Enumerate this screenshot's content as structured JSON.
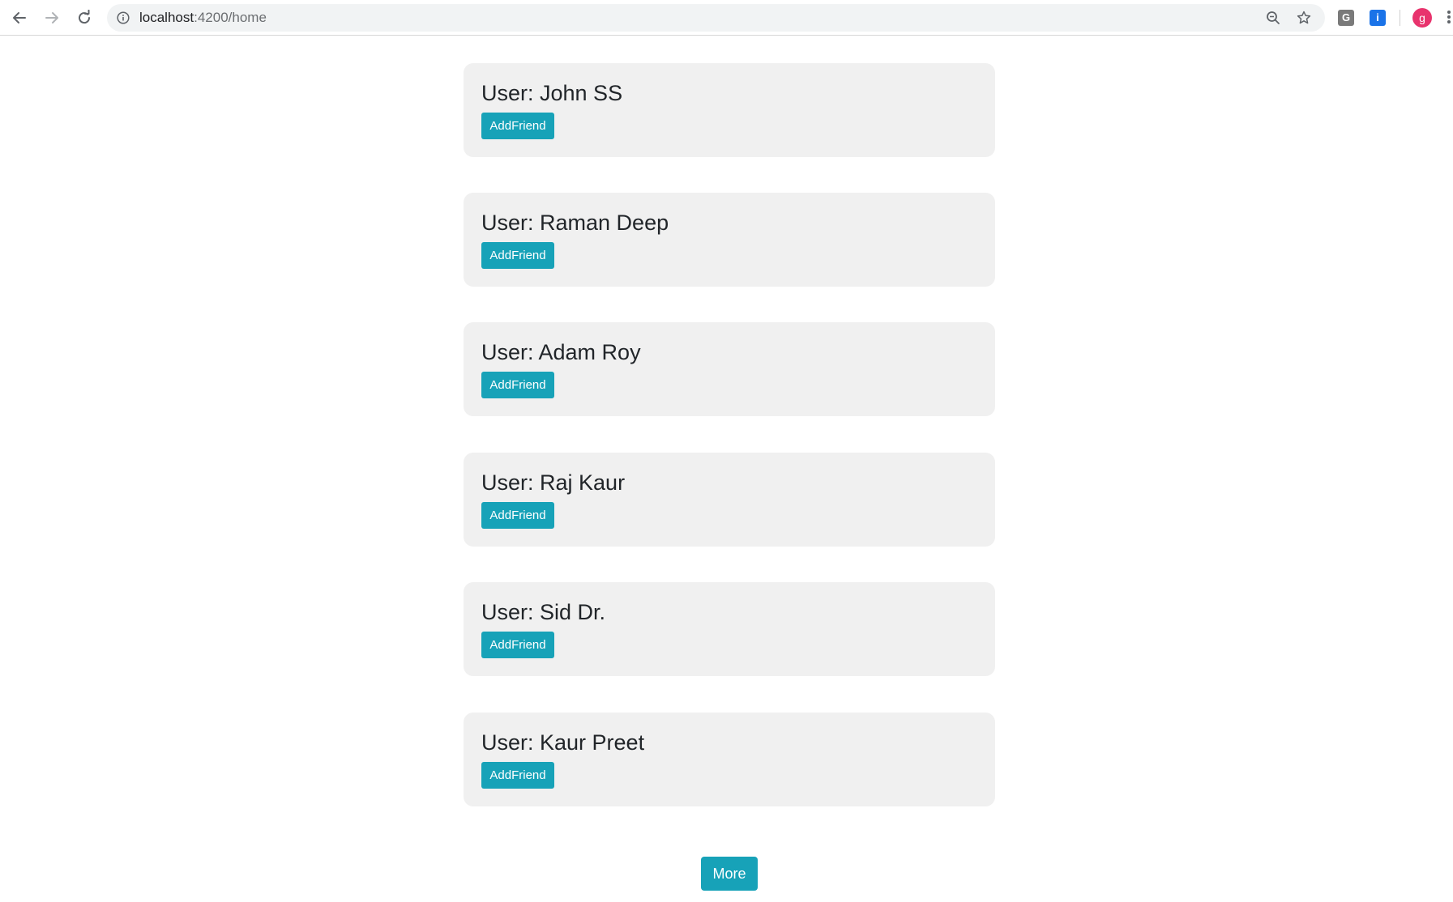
{
  "browser": {
    "url_host": "localhost",
    "url_path": ":4200/home",
    "extensions": [
      {
        "name": "grammar-extension-icon",
        "glyph": "G",
        "color": "#7a7a7a"
      },
      {
        "name": "info-extension-icon",
        "glyph": "i",
        "color": "#1a73e8"
      }
    ],
    "profile": {
      "initial": "g",
      "color": "#e8336d"
    }
  },
  "users": [
    {
      "title": "User: John SS",
      "button": "AddFriend"
    },
    {
      "title": "User: Raman Deep",
      "button": "AddFriend"
    },
    {
      "title": "User: Adam Roy",
      "button": "AddFriend"
    },
    {
      "title": "User: Raj Kaur",
      "button": "AddFriend"
    },
    {
      "title": "User: Sid Dr.",
      "button": "AddFriend"
    },
    {
      "title": "User: Kaur Preet",
      "button": "AddFriend"
    }
  ],
  "more_button": "More",
  "colors": {
    "accent": "#17a2b8",
    "card_bg": "#f0f0f0"
  }
}
